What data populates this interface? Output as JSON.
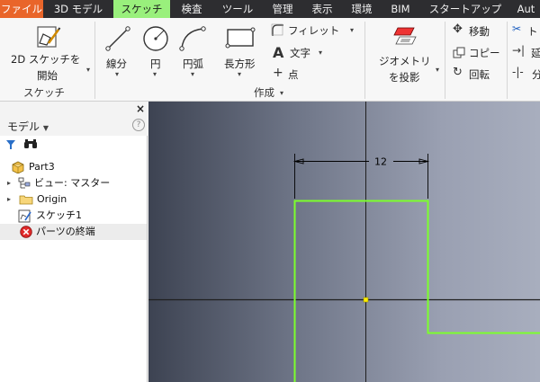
{
  "menu": {
    "items": [
      {
        "label": "ファイル",
        "state": "file"
      },
      {
        "label": "3D モデル",
        "state": ""
      },
      {
        "label": "スケッチ",
        "state": "active"
      },
      {
        "label": "検査",
        "state": ""
      },
      {
        "label": "ツール",
        "state": ""
      },
      {
        "label": "管理",
        "state": ""
      },
      {
        "label": "表示",
        "state": ""
      },
      {
        "label": "環境",
        "state": ""
      },
      {
        "label": "BIM",
        "state": ""
      },
      {
        "label": "スタートアップ",
        "state": ""
      },
      {
        "label": "Aut",
        "state": ""
      }
    ]
  },
  "ribbon": {
    "sketch_panel": {
      "btn_line1": "2D スケッチを",
      "btn_line2": "開始",
      "label": "スケッチ"
    },
    "create_panel": {
      "line": "線分",
      "circle": "円",
      "arc": "円弧",
      "rectangle": "長方形",
      "fillet": "フィレット",
      "text": "文字",
      "point": "点",
      "label": "作成"
    },
    "project": {
      "line1": "ジオメトリ",
      "line2": "を投影"
    },
    "modify": {
      "move": "移動",
      "copy": "コピー",
      "rotate": "回転",
      "trim_partial": "ト",
      "extend_partial": "延",
      "split_partial": "分"
    }
  },
  "browser": {
    "title": "モデル",
    "help": "?",
    "close": "×",
    "items": [
      {
        "label": "Part3",
        "icon": "part-icon",
        "expander": ""
      },
      {
        "label": "ビュー: マスター",
        "icon": "view-rep-icon",
        "expander": "▸"
      },
      {
        "label": "Origin",
        "icon": "folder-icon",
        "expander": "▸"
      },
      {
        "label": "スケッチ1",
        "icon": "sketch-icon",
        "expander": ""
      },
      {
        "label": "パーツの終端",
        "icon": "end-of-part-icon",
        "expander": ""
      }
    ]
  },
  "canvas": {
    "dimension_value": "12",
    "colors": {
      "sketch_line": "#7cff2c",
      "axis": "#1f1f1f",
      "center_point": "#ffee00",
      "dimension": "#000000"
    }
  },
  "colors": {
    "menubar": "#2d2d30",
    "file_tab": "#e9652a",
    "active_tab": "#99f07c",
    "ribbon": "#f7f7f7"
  }
}
